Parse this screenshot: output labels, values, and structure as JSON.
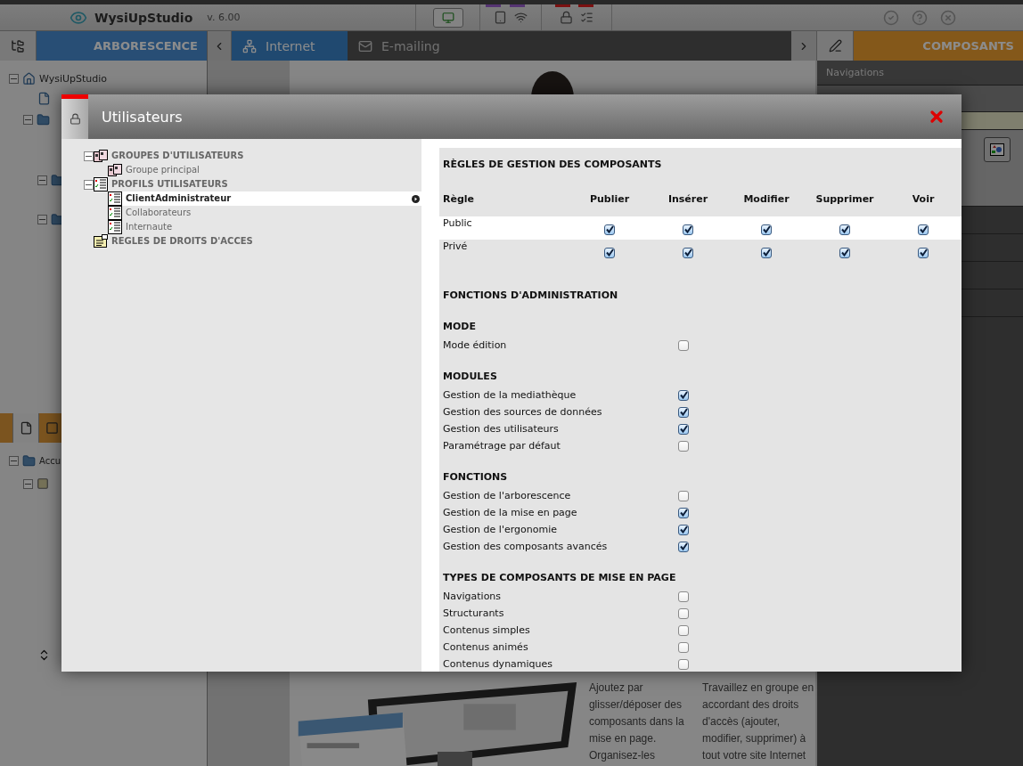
{
  "app": {
    "logo": "WysiUpStudio",
    "version": "v. 6.00"
  },
  "explorer": {
    "title": "ARBORESCENCE",
    "tree": [
      {
        "label": "WysiUpStudio",
        "expanded": true
      }
    ],
    "lower_tree": [
      {
        "label": "Accu",
        "expanded": true
      }
    ]
  },
  "editor": {
    "tabs": [
      {
        "label": "Internet",
        "selected": true,
        "kind": "site"
      },
      {
        "label": "E-mailing",
        "selected": false,
        "kind": "mail"
      }
    ],
    "paragraphs": [
      "Ajoutez par glisser/déposer des composants dans la mise en page. Organisez-les",
      "Travaillez en groupe en accordant des droits d'accès (ajouter, modifier, supprimer) à tout votre site Internet"
    ]
  },
  "components": {
    "title": "COMPOSANTS",
    "items": [
      "Navigations"
    ]
  },
  "dialog": {
    "title": "Utilisateurs",
    "tree": [
      {
        "label": "GROUPES D'UTILISATEURS",
        "kind": "group",
        "selected": false,
        "expanded": true,
        "children": [
          {
            "label": "Groupe principal",
            "kind": "group",
            "selected": false
          }
        ]
      },
      {
        "label": "PROFILS UTILISATEURS",
        "kind": "profile",
        "selected": false,
        "expanded": true,
        "children": [
          {
            "label": "ClientAdministrateur",
            "kind": "profile",
            "selected": true
          },
          {
            "label": "Collaborateurs",
            "kind": "profile",
            "selected": false
          },
          {
            "label": "Internaute",
            "kind": "profile",
            "selected": false
          }
        ]
      },
      {
        "label": "REGLES DE DROITS D'ACCES",
        "kind": "rules",
        "selected": false
      }
    ],
    "rules": {
      "title": "RÈGLES DE GESTION DES COMPOSANTS",
      "columns": [
        "Règle",
        "Publier",
        "Insérer",
        "Modifier",
        "Supprimer",
        "Voir"
      ],
      "rows": [
        {
          "name": "Public",
          "cells": [
            {
              "checked": true
            },
            {
              "checked": true
            },
            {
              "checked": true
            },
            {
              "checked": true
            },
            {
              "checked": true
            }
          ]
        },
        {
          "name": "Privé",
          "cells": [
            {
              "checked": true
            },
            {
              "checked": true
            },
            {
              "checked": true
            },
            {
              "checked": true
            },
            {
              "checked": true
            }
          ]
        }
      ]
    },
    "admin": {
      "title": "FONCTIONS D'ADMINISTRATION",
      "groups": [
        {
          "title": "MODE",
          "options": [
            {
              "label": "Mode édition",
              "checked": false
            }
          ]
        },
        {
          "title": "MODULES",
          "options": [
            {
              "label": "Gestion de la mediathèque",
              "checked": true
            },
            {
              "label": "Gestion des sources de données",
              "checked": true
            },
            {
              "label": "Gestion des utilisateurs",
              "checked": true
            },
            {
              "label": "Paramétrage par défaut",
              "checked": false
            }
          ]
        },
        {
          "title": "FONCTIONS",
          "options": [
            {
              "label": "Gestion de l'arborescence",
              "checked": false
            },
            {
              "label": "Gestion de la mise en page",
              "checked": true
            },
            {
              "label": "Gestion de l'ergonomie",
              "checked": true
            },
            {
              "label": "Gestion des composants avancés",
              "checked": true
            }
          ]
        },
        {
          "title": "TYPES DE COMPOSANTS DE MISE EN PAGE",
          "options": [
            {
              "label": "Navigations",
              "checked": false
            },
            {
              "label": "Structurants",
              "checked": false
            },
            {
              "label": "Contenus simples",
              "checked": false
            },
            {
              "label": "Contenus animés",
              "checked": false
            },
            {
              "label": "Contenus dynamiques",
              "checked": false
            }
          ]
        }
      ]
    }
  }
}
